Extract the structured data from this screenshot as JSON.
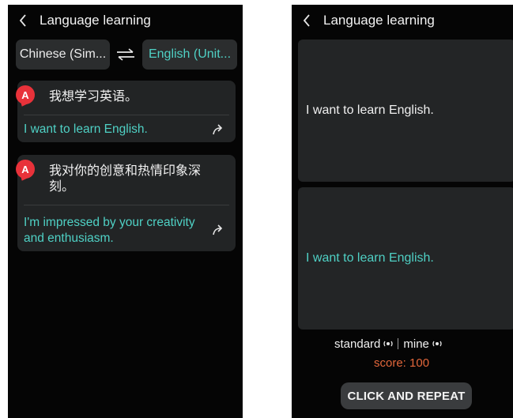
{
  "left_screen": {
    "header": {
      "title": "Language learning"
    },
    "language_selector": {
      "source": "Chinese (Sim...",
      "target": "English (Unit..."
    },
    "conversation": [
      {
        "speaker_badge": "A",
        "source_text": "我想学习英语。",
        "translation": "I want to learn English."
      },
      {
        "speaker_badge": "A",
        "source_text": "我对你的创意和热情印象深刻。",
        "translation": "I'm impressed by your creativity and enthusiasm."
      }
    ]
  },
  "right_screen": {
    "header": {
      "title": "Language learning"
    },
    "standard_text": "I want to learn English.",
    "mine_text": "I want to learn English.",
    "standard_label": "standard",
    "mine_label": "mine",
    "score_label": "score:",
    "score_value": "100",
    "repeat_button": "CLICK AND REPEAT"
  },
  "colors": {
    "accent_teal": "#4fd1c5",
    "badge_red": "#e8323a",
    "score_orange": "#e3673b",
    "background": "#050505",
    "card": "#222425"
  },
  "icons": [
    "back-chevron-icon",
    "swap-arrows-icon",
    "share-forward-icon",
    "audio-play-icon"
  ]
}
